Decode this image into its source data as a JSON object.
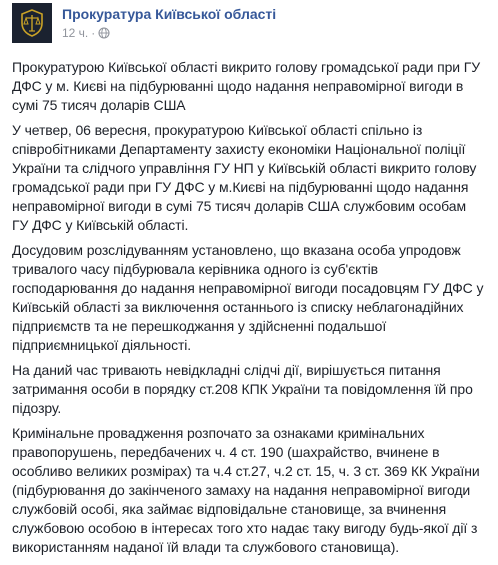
{
  "page": {
    "name": "Прокуратура Київської області",
    "timestamp": "12 ч.",
    "separator": "·",
    "audience_icon": "globe-icon",
    "avatar_icon": "prosecutor-emblem-icon"
  },
  "post": {
    "paragraphs": [
      "Прокуратурою Київської області викрито голову громадської ради при ГУ ДФС у м. Києві на підбурюванні щодо надання неправомірної вигоди в сумі 75 тисяч доларів США",
      "У четвер, 06 вересня, прокуратурою Київської області спільно із співробітниками Департаменту захисту економіки Національної поліції України та слідчого управління ГУ НП у Київській області викрито голову громадської ради при ГУ ДФС у м.Києві на підбурюванні щодо надання неправомірної вигоди в сумі 75 тисяч доларів США службовим особам ГУ ДФС у Київській області.",
      "Досудовим розслідуванням установлено, що вказана особа упродовж тривалого часу підбурювала керівника одного із суб'єктів господарювання до надання неправомірної вигоди посадовцям ГУ ДФС у Київській області за виключення останнього із списку неблагонадійних підприємств та не перешкоджання у здійсненні подальшої підприємницької діяльності.",
      "На даний час тривають невідкладні слідчі дії, вирішується питання затримання особи в порядку ст.208 КПК України та повідомлення їй про підозру.",
      "Кримінальне провадження розпочато за ознаками кримінальних правопорушень, передбачених ч. 4 ст. 190 (шахрайство, вчинене в особливо великих розмірах) та ч.4 ст.27, ч.2 ст. 15, ч. 3 ст. 369 КК України (підбурювання до закінченого замаху на надання неправомірної вигоди службовій особі, яка займає відповідальне становище, за вчинення службовою особою в інтересах того хто надає таку вигоду будь-якої дії з використанням наданої їй влади та службового становища)."
    ]
  },
  "colors": {
    "link": "#365899",
    "text": "#1d2129",
    "meta": "#90949c",
    "avatar_bg": "#1b2230",
    "emblem_gold": "#c9a227"
  }
}
